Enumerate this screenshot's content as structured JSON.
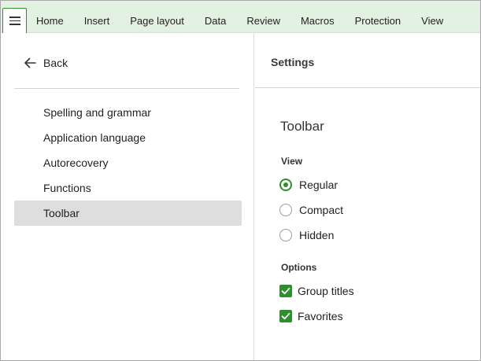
{
  "ribbon": {
    "menu_icon": "hamburger-icon",
    "tabs": [
      "Home",
      "Insert",
      "Page layout",
      "Data",
      "Review",
      "Macros",
      "Protection",
      "View"
    ]
  },
  "left_pane": {
    "back_label": "Back",
    "back_icon": "arrow-left-icon",
    "items": [
      {
        "label": "Spelling and grammar"
      },
      {
        "label": "Application language"
      },
      {
        "label": "Autorecovery"
      },
      {
        "label": "Functions"
      },
      {
        "label": "Toolbar",
        "active": true
      }
    ]
  },
  "right_pane": {
    "header": "Settings",
    "section_title": "Toolbar",
    "view_group": {
      "label": "View",
      "options": [
        {
          "label": "Regular",
          "selected": true
        },
        {
          "label": "Compact",
          "selected": false
        },
        {
          "label": "Hidden",
          "selected": false
        }
      ]
    },
    "options_group": {
      "label": "Options",
      "checkboxes": [
        {
          "label": "Group titles",
          "checked": true
        },
        {
          "label": "Favorites",
          "checked": true
        }
      ]
    }
  },
  "colors": {
    "accent": "#2f8f2f",
    "ribbon_bg": "#e3f1e3",
    "active_item_bg": "#dedede"
  }
}
